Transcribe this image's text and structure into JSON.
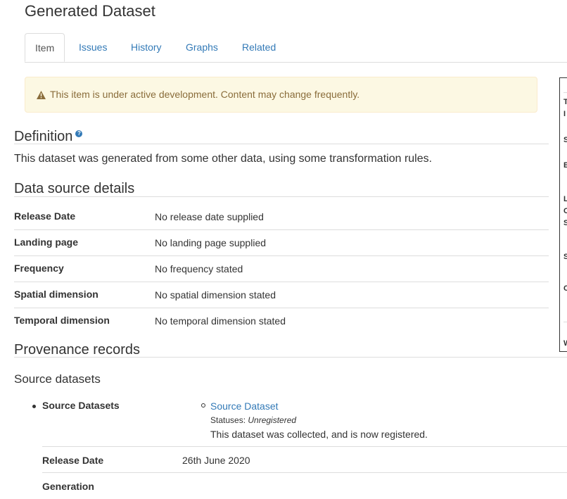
{
  "page_title": "Generated Dataset",
  "tabs": [
    {
      "label": "Item",
      "active": true
    },
    {
      "label": "Issues",
      "active": false
    },
    {
      "label": "History",
      "active": false
    },
    {
      "label": "Graphs",
      "active": false
    },
    {
      "label": "Related",
      "active": false
    }
  ],
  "alert": {
    "icon": "warning-icon",
    "text": "This item is under active development. Content may change frequently."
  },
  "definition": {
    "heading": "Definition",
    "help_icon": "question-circle-icon",
    "text": "This dataset was generated from some other data, using some transformation rules."
  },
  "data_source": {
    "heading": "Data source details",
    "rows": [
      {
        "label": "Release Date",
        "value": "No release date supplied"
      },
      {
        "label": "Landing page",
        "value": "No landing page supplied"
      },
      {
        "label": "Frequency",
        "value": "No frequency stated"
      },
      {
        "label": "Spatial dimension",
        "value": "No spatial dimension stated"
      },
      {
        "label": "Temporal dimension",
        "value": "No temporal dimension stated"
      }
    ]
  },
  "provenance": {
    "heading": "Provenance records",
    "subheading": "Source datasets",
    "source_datasets_label": "Source Datasets",
    "source": {
      "link": "Source Dataset",
      "statuses_label": "Statuses:",
      "status": "Unregistered",
      "description": "This dataset was collected, and is now registered."
    },
    "rows": [
      {
        "label": "Release Date",
        "value": "26th June 2020"
      },
      {
        "label": "Generation",
        "value": ""
      }
    ]
  },
  "side_panel": {
    "letters": [
      "T",
      "I",
      "S",
      "E",
      "L",
      "C",
      "S",
      "S",
      "C",
      "W"
    ]
  },
  "colors": {
    "link": "#337ab7",
    "alert_bg": "#fcf8e3",
    "alert_text": "#8a6d3b",
    "border": "#dddddd"
  }
}
